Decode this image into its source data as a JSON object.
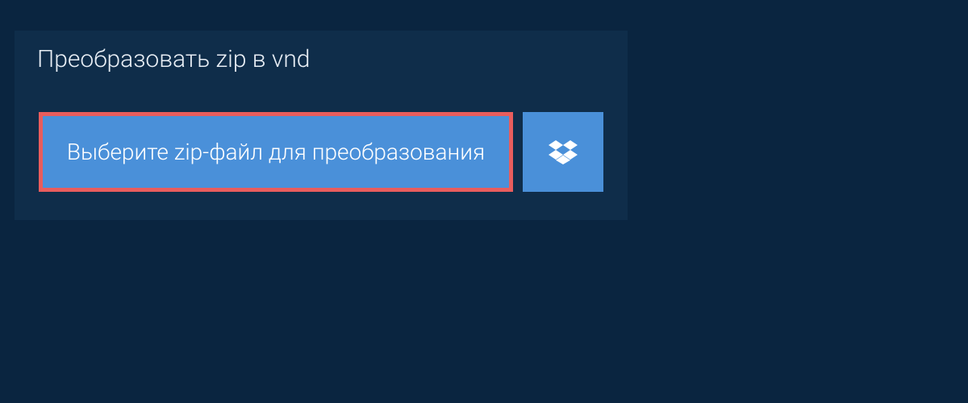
{
  "header": {
    "title": "Преобразовать zip в vnd"
  },
  "upload": {
    "select_file_label": "Выберите zip-файл для преобразования"
  },
  "colors": {
    "background": "#0a2540",
    "panel": "#0f2d4a",
    "button": "#4a90d9",
    "highlight_border": "#e85d5d",
    "text_light": "#e8eef5",
    "text_white": "#ffffff"
  }
}
